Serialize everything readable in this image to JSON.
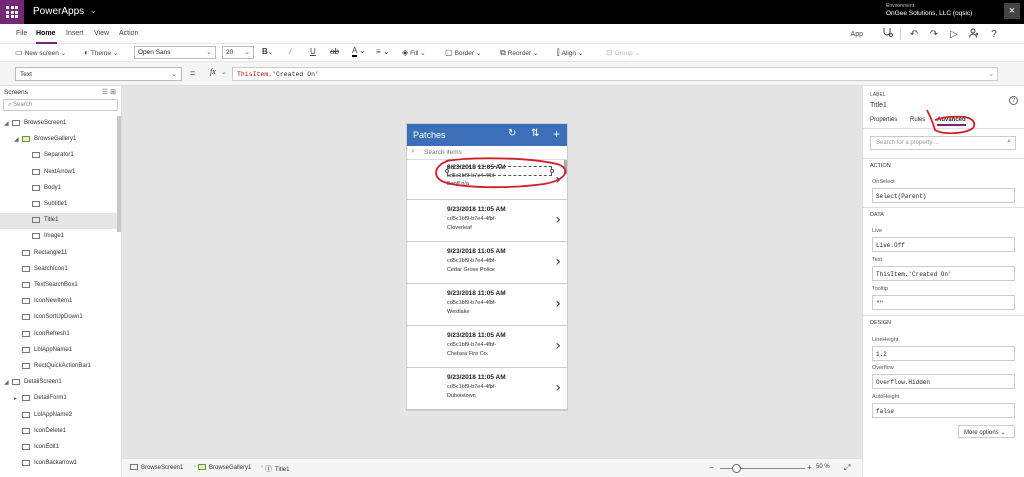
{
  "app": {
    "name": "PowerApps",
    "environment_label": "Environment",
    "environment_name": "OnGee Solutions, LLC (oqslc)"
  },
  "menu": {
    "file": "File",
    "home": "Home",
    "insert": "Insert",
    "view": "View",
    "action": "Action",
    "app": "App"
  },
  "ribbon": {
    "new_screen": "New screen",
    "theme": "Theme",
    "font": "Open Sans",
    "font_size": "20",
    "fill": "Fill",
    "border": "Border",
    "reorder": "Reorder",
    "align": "Align",
    "group": "Group"
  },
  "formula": {
    "property": "Text",
    "eq": "=",
    "fx": "fx",
    "fn_part": "ThisItem.",
    "str_part": "'Created On'"
  },
  "left_panel": {
    "title": "Screens",
    "search_placeholder": "Search",
    "tree": [
      {
        "label": "BrowseScreen1",
        "level": 0,
        "type": "screen",
        "expanded": true
      },
      {
        "label": "BrowseGallery1",
        "level": 1,
        "type": "gallery",
        "expanded": true
      },
      {
        "label": "Separator1",
        "level": 2,
        "type": "control"
      },
      {
        "label": "NextArrow1",
        "level": 2,
        "type": "control"
      },
      {
        "label": "Body1",
        "level": 2,
        "type": "control"
      },
      {
        "label": "Subtitle1",
        "level": 2,
        "type": "control"
      },
      {
        "label": "Title1",
        "level": 2,
        "type": "control",
        "selected": true
      },
      {
        "label": "Image1",
        "level": 2,
        "type": "control"
      },
      {
        "label": "Rectangle11",
        "level": 1,
        "type": "control"
      },
      {
        "label": "SearchIcon1",
        "level": 1,
        "type": "control"
      },
      {
        "label": "TextSearchBox1",
        "level": 1,
        "type": "control"
      },
      {
        "label": "IconNewItem1",
        "level": 1,
        "type": "control"
      },
      {
        "label": "IconSortUpDown1",
        "level": 1,
        "type": "control"
      },
      {
        "label": "IconRefresh1",
        "level": 1,
        "type": "control"
      },
      {
        "label": "LblAppName1",
        "level": 1,
        "type": "control"
      },
      {
        "label": "RectQuickActionBar1",
        "level": 1,
        "type": "control"
      },
      {
        "label": "DetailScreen1",
        "level": 0,
        "type": "screen",
        "expanded": true
      },
      {
        "label": "DetailForm1",
        "level": 1,
        "type": "form",
        "expanded": false
      },
      {
        "label": "LblAppName2",
        "level": 1,
        "type": "control"
      },
      {
        "label": "IconDelete1",
        "level": 1,
        "type": "control"
      },
      {
        "label": "IconEdit1",
        "level": 1,
        "type": "control"
      },
      {
        "label": "IconBackarrow1",
        "level": 1,
        "type": "control"
      }
    ]
  },
  "phone": {
    "title": "Patches",
    "search_placeholder": "Search items",
    "items": [
      {
        "title": "9/23/2018 11:05 AM",
        "subtitle": "cd5c1bf9-b7e4-4fbf-",
        "body": "Banff   n/a"
      },
      {
        "title": "9/23/2018 11:05 AM",
        "subtitle": "cd5c1bf9-b7e4-4fbf-",
        "body": "Cloverleaf"
      },
      {
        "title": "9/23/2018 11:05 AM",
        "subtitle": "cd5c1bf9-b7e4-4fbf-",
        "body": "Cedar Grove Police"
      },
      {
        "title": "9/23/2018 11:05 AM",
        "subtitle": "cd5c1bf9-b7e4-4fbf-",
        "body": "Westlake"
      },
      {
        "title": "9/23/2018 11:05 AM",
        "subtitle": "cd5c1bf9-b7e4-4fbf-",
        "body": "Chelsea Fire Co."
      },
      {
        "title": "9/23/2018 11:05 AM",
        "subtitle": "cd5c1bf9-b7e4-4fbf-",
        "body": "Duboistown"
      }
    ]
  },
  "bottom": {
    "crumb1": "BrowseScreen1",
    "crumb2": "BrowseGallery1",
    "crumb3": "Title1",
    "zoom": "50",
    "zoom_unit": "%"
  },
  "right_panel": {
    "kind": "LABEL",
    "name": "Title1",
    "tabs": {
      "properties": "Properties",
      "rules": "Rules",
      "advanced": "Advanced"
    },
    "search_placeholder": "Search for a property ...",
    "sections": {
      "action": "ACTION",
      "data": "DATA",
      "design": "DESIGN"
    },
    "fields": {
      "onselect_label": "OnSelect",
      "onselect_value": "Select(Parent)",
      "live_label": "Live",
      "live_value": "Live.Off",
      "text_label": "Text",
      "text_value": "ThisItem.'Created On'",
      "tooltip_label": "Tooltip",
      "tooltip_value": "\"\"",
      "lineheight_label": "LineHeight",
      "lineheight_value": "1.2",
      "overflow_label": "Overflow",
      "overflow_value": "Overflow.Hidden",
      "autoheight_label": "AutoHeight",
      "autoheight_value": "false"
    },
    "more_options": "More options"
  },
  "colors": {
    "brand": "#742774",
    "phone_header": "#3b6fb8",
    "annotation": "#d0202a"
  }
}
